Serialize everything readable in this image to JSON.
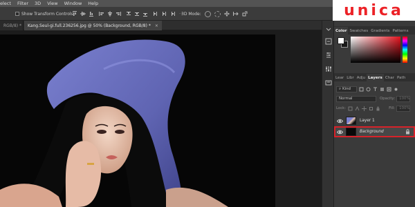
{
  "menu": [
    "elect",
    "Filter",
    "3D",
    "View",
    "Window",
    "Help"
  ],
  "options_bar": {
    "transform_label": "Show Transform Controls",
    "mode_label": "3D Mode:"
  },
  "tabs": {
    "previous": "RGB/8) *",
    "active": "Kang.Seul-gi.full.236256.jpg @ 50% (Background, RGB/8) *",
    "close_glyph": "×"
  },
  "panel_tabs_top": [
    "Color",
    "Swatches",
    "Gradients",
    "Patterns"
  ],
  "panel_tabs_layers": [
    "Lear",
    "Libr",
    "Adju",
    "Layers",
    "Char",
    "Path"
  ],
  "layers_controls": {
    "kind_label": "Kind",
    "blend_mode": "Normal",
    "opacity_label": "Opacity:",
    "opacity_value": "100%",
    "lock_label": "Lock:",
    "fill_label": "Fill:",
    "fill_value": "100%"
  },
  "layers": [
    {
      "name": "Layer 1"
    },
    {
      "name": "Background"
    }
  ],
  "logo": "unica",
  "colors": {
    "accent": "#ec2227",
    "hat": "#6a6fc0",
    "fg_swatch": "#ffffff",
    "bg_swatch": "#1a1a1a"
  },
  "icons": [
    "align-left-icon",
    "align-center-icon",
    "align-right-icon",
    "orbit-icon",
    "roll-icon",
    "pan-icon",
    "slide-icon",
    "scale-icon",
    "eye-icon",
    "lock-icon"
  ]
}
